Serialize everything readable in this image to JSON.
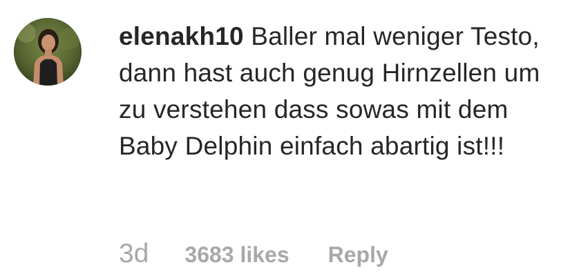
{
  "comment": {
    "avatar_icon": "user-avatar-photo",
    "username": "elenakh10",
    "text": "Baller mal weniger Testo, dann hast auch genug Hirnzellen um zu verstehen dass sowas mit dem Baby Delphin einfach abartig ist!!!",
    "timestamp": "3d",
    "likes": "3683 likes",
    "reply_label": "Reply"
  },
  "colors": {
    "text": "#262626",
    "meta": "#a8a8a8",
    "background": "#ffffff"
  }
}
